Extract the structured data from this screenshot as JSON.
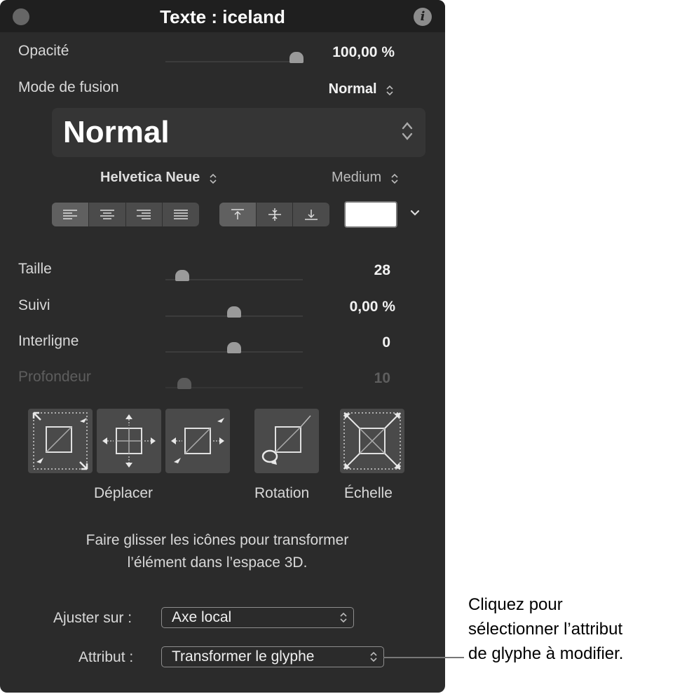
{
  "window": {
    "title": "Texte : iceland",
    "info_icon": "info-icon"
  },
  "opacity": {
    "label": "Opacité",
    "value": "100,00 %",
    "level": 1.0
  },
  "blend": {
    "label": "Mode de fusion",
    "value": "Normal"
  },
  "font_preview": {
    "value": "Normal"
  },
  "font": {
    "family": "Helvetica Neue",
    "weight": "Medium"
  },
  "align_buttons": [
    "align-left",
    "align-center",
    "align-right",
    "align-justify"
  ],
  "valign_buttons": [
    "align-top",
    "align-middle",
    "align-bottom"
  ],
  "color_swatch": "#ffffff",
  "params": [
    {
      "label": "Taille",
      "value": "28",
      "level": 0.12,
      "enabled": true
    },
    {
      "label": "Suivi",
      "value": "0,00 %",
      "level": 0.5,
      "enabled": true
    },
    {
      "label": "Interligne",
      "value": "0",
      "level": 0.5,
      "enabled": true
    },
    {
      "label": "Profondeur",
      "value": "10",
      "level": 0.14,
      "enabled": false
    }
  ],
  "transform_tools": {
    "move_label": "Déplacer",
    "rotate_label": "Rotation",
    "scale_label": "Échelle"
  },
  "hint": {
    "line1": "Faire glisser les icônes pour transformer",
    "line2": "l’élément dans l’espace 3D."
  },
  "adjust": {
    "label": "Ajuster sur :",
    "value": "Axe local"
  },
  "attribute": {
    "label": "Attribut :",
    "value": "Transformer le glyphe"
  },
  "callout": {
    "line1": "Cliquez pour",
    "line2": "sélectionner l’attribut",
    "line3": "de glyphe à modifier."
  },
  "colors": {
    "panel_bg": "#2b2b2b",
    "titlebar_bg": "#1f1f1f",
    "button_bg": "#4a4a4a"
  }
}
